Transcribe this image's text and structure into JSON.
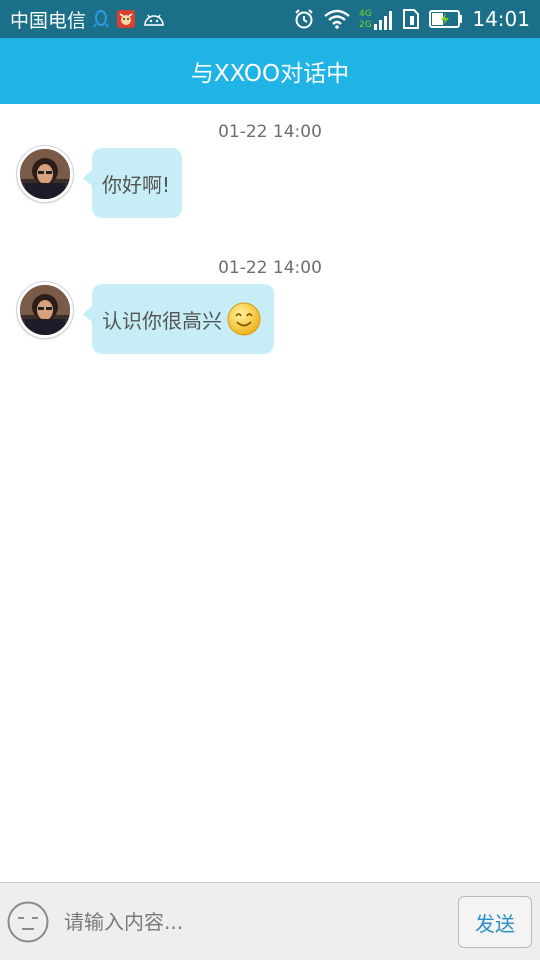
{
  "status_bar": {
    "carrier": "中国电信",
    "network_badge_top": "4G",
    "network_badge_bottom": "2G",
    "time": "14:01",
    "icons": [
      "qq-icon",
      "app-notification-icon",
      "android-icon",
      "alarm-icon",
      "wifi-icon",
      "signal-icon",
      "sim-icon",
      "battery-charging-icon"
    ]
  },
  "header": {
    "title": "与XXOO对话中"
  },
  "messages": [
    {
      "time": "01-22 14:00",
      "text": "你好啊!",
      "emoji": ""
    },
    {
      "time": "01-22 14:00",
      "text": "认识你很高兴",
      "emoji": "smile-emoji"
    }
  ],
  "input_bar": {
    "placeholder": "请输入内容...",
    "value": "",
    "send_label": "发送",
    "emoji_icon": "face-icon"
  },
  "colors": {
    "status_bar": "#1b6f88",
    "header": "#1fb3e6",
    "bubble": "#c7eef6",
    "send_text": "#2a90c8"
  }
}
